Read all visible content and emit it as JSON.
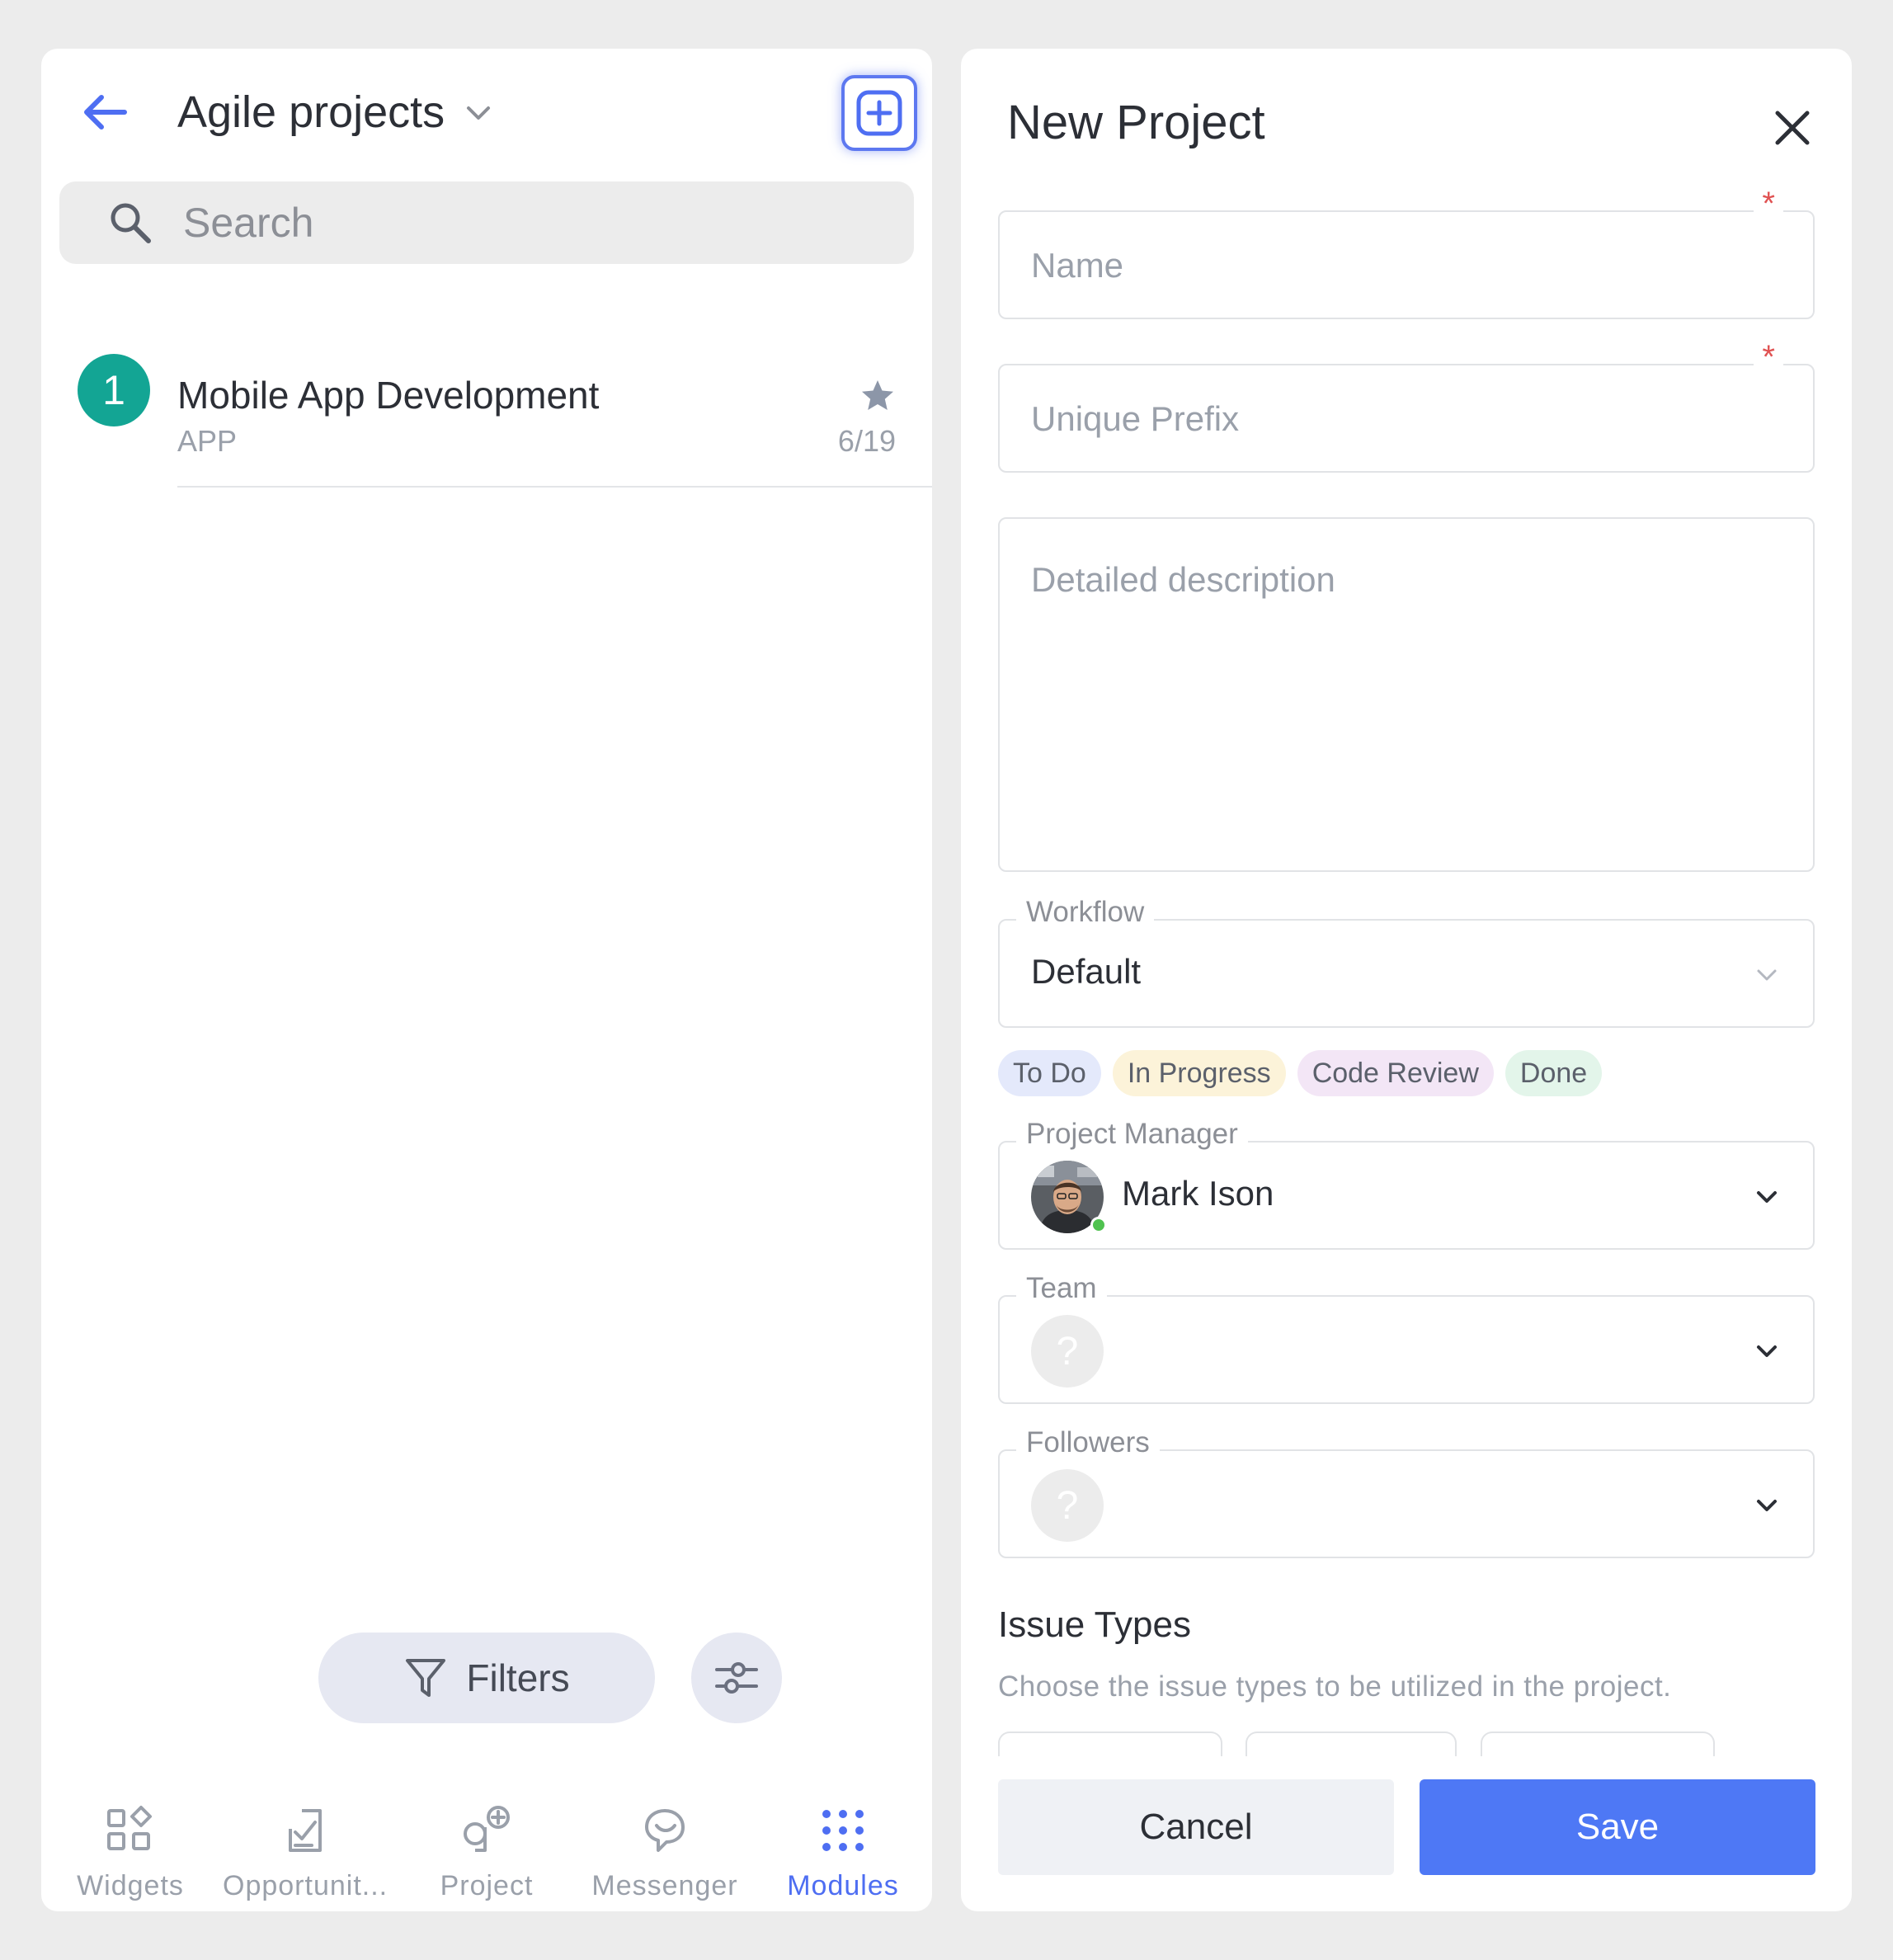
{
  "left_panel": {
    "title": "Agile projects",
    "search": {
      "placeholder": "Search"
    },
    "projects": [
      {
        "number": "1",
        "name": "Mobile App Development",
        "code": "APP",
        "count": "6/19",
        "starred": true,
        "badge_color": "#13a594"
      }
    ],
    "filters_label": "Filters",
    "bottom_nav": [
      {
        "label": "Widgets",
        "icon": "widgets-icon",
        "active": false
      },
      {
        "label": "Opportunit...",
        "icon": "opportunities-icon",
        "active": false
      },
      {
        "label": "Project",
        "icon": "project-icon",
        "active": false
      },
      {
        "label": "Messenger",
        "icon": "messenger-icon",
        "active": false
      },
      {
        "label": "Modules",
        "icon": "modules-grid-icon",
        "active": true
      }
    ]
  },
  "modal": {
    "title": "New Project",
    "name_field": {
      "placeholder": "Name",
      "required_mark": "*"
    },
    "prefix_field": {
      "placeholder": "Unique Prefix",
      "required_mark": "*"
    },
    "description_field": {
      "placeholder": "Detailed description"
    },
    "workflow": {
      "label": "Workflow",
      "value": "Default"
    },
    "workflow_statuses": [
      {
        "label": "To Do",
        "color": "#e4e9fb"
      },
      {
        "label": "In Progress",
        "color": "#fcf3d9"
      },
      {
        "label": "Code Review",
        "color": "#f3e6f6"
      },
      {
        "label": "Done",
        "color": "#e3f5ea"
      }
    ],
    "project_manager": {
      "label": "Project Manager",
      "value": "Mark Ison"
    },
    "team": {
      "label": "Team",
      "placeholder": "?"
    },
    "followers": {
      "label": "Followers",
      "placeholder": "?"
    },
    "issue_types": {
      "title": "Issue Types",
      "description": "Choose the issue types to be utilized in the project."
    },
    "cancel_label": "Cancel",
    "save_label": "Save"
  },
  "colors": {
    "accent": "#4e78f5",
    "active_nav": "#4e6ef2",
    "required": "#e05252"
  }
}
